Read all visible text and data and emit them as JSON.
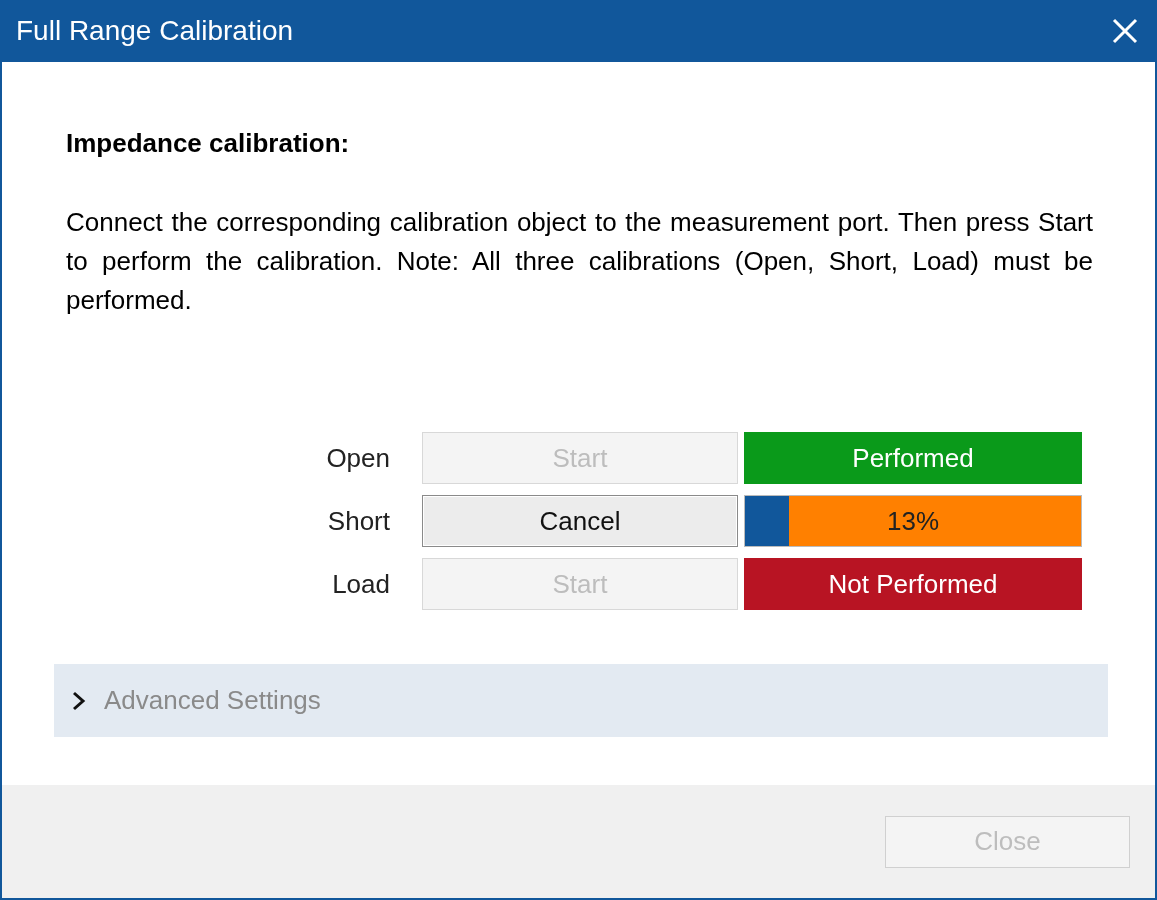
{
  "window": {
    "title": "Full Range Calibration"
  },
  "heading": "Impedance calibration:",
  "description": "Connect the corresponding calibration object to the measurement port. Then press Start to perform the calibration. Note: All three calibrations (Open, Short, Load) must be performed.",
  "calibrations": [
    {
      "label": "Open",
      "button": {
        "label": "Start",
        "disabled": true
      },
      "status": {
        "kind": "performed",
        "text": "Performed"
      }
    },
    {
      "label": "Short",
      "button": {
        "label": "Cancel",
        "disabled": false
      },
      "status": {
        "kind": "progress",
        "text": "13%",
        "level": 0.13
      }
    },
    {
      "label": "Load",
      "button": {
        "label": "Start",
        "disabled": true
      },
      "status": {
        "kind": "not_performed",
        "text": "Not Performed"
      }
    }
  ],
  "advanced": {
    "label": "Advanced Settings",
    "expanded": false
  },
  "footer": {
    "close_button": {
      "label": "Close",
      "disabled": true
    }
  }
}
